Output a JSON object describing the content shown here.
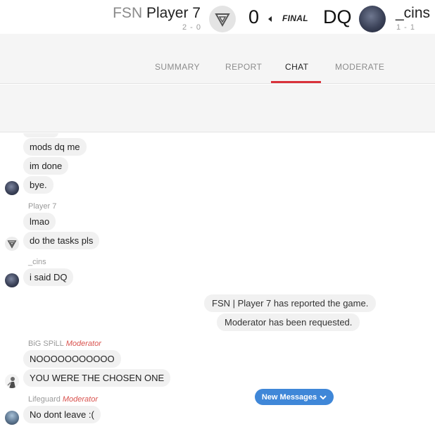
{
  "match": {
    "player1": {
      "tag": "FSN",
      "name": "Player 7",
      "record": "2 - 0",
      "score": "0"
    },
    "status": "FINAL",
    "player2": {
      "name": "_cins",
      "record": "1 - 1",
      "score": "DQ"
    }
  },
  "tabs": [
    {
      "label": "SUMMARY",
      "active": false
    },
    {
      "label": "REPORT",
      "active": false
    },
    {
      "label": "CHAT",
      "active": true
    },
    {
      "label": "MODERATE",
      "active": false
    }
  ],
  "chat": {
    "messages": [
      {
        "text": "mods dq me"
      },
      {
        "text": "im done"
      },
      {
        "text": "bye."
      },
      {
        "author": "Player 7",
        "text": "lmao"
      },
      {
        "text": "do the tasks pls"
      },
      {
        "author": "_cins",
        "text": "i said DQ"
      },
      {
        "system": true,
        "text": "FSN | Player 7 has reported the game."
      },
      {
        "system": true,
        "text": "Moderator has been requested."
      },
      {
        "author": "BiG SPiLL",
        "role": "Moderator",
        "text": "NOOOOOOOOOOO"
      },
      {
        "text": "YOU WERE THE CHOSEN ONE"
      },
      {
        "author": "Lifeguard",
        "role": "Moderator",
        "text": "No dont leave :("
      }
    ],
    "new_messages_label": "New Messages"
  },
  "colors": {
    "accent_red": "#d9323b",
    "moderator": "#d9534f",
    "new_messages_bg": "#3f87d8",
    "bubble_bg": "#f1f1f1"
  },
  "icons": {
    "player1_avatar": "v-logo-icon",
    "caret": "caret-left-icon",
    "new_messages": "chevron-down-icon"
  }
}
